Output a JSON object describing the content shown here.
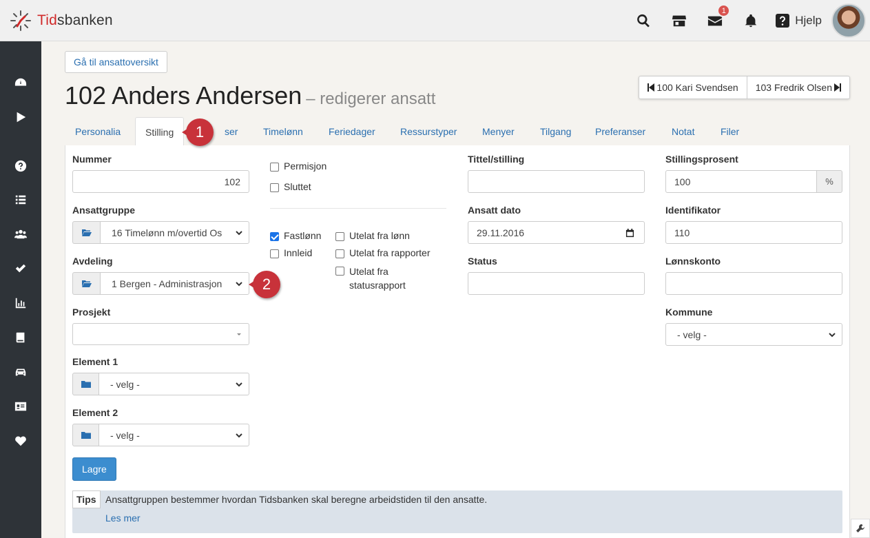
{
  "app": {
    "logo_prefix": "Tid",
    "logo_suffix": "sbanken"
  },
  "topbar": {
    "mail_badge": "1",
    "help_label": "Hjelp"
  },
  "sidebar": {
    "items": [
      "dashboard-icon",
      "play-icon",
      "question-icon",
      "list-icon",
      "users-icon",
      "check-icon",
      "chart-icon",
      "book-icon",
      "car-icon",
      "id-card-icon",
      "heart-icon"
    ]
  },
  "header": {
    "overview_button": "Gå til ansattoversikt",
    "title": "102 Anders Andersen",
    "subtitle": "– redigerer ansatt",
    "prev_employee": "100 Kari Svendsen",
    "next_employee": "103 Fredrik Olsen"
  },
  "tabs": [
    "Personalia",
    "Stilling",
    "ser",
    "Timelønn",
    "Feriedager",
    "Ressurstyper",
    "Menyer",
    "Tilgang",
    "Preferanser",
    "Notat",
    "Filer"
  ],
  "form": {
    "nummer_label": "Nummer",
    "nummer_value": "102",
    "ansattgruppe_label": "Ansattgruppe",
    "ansattgruppe_value": "16 Timelønn m/overtid Os",
    "avdeling_label": "Avdeling",
    "avdeling_value": "1 Bergen - Administrasjon",
    "prosjekt_label": "Prosjekt",
    "prosjekt_value": "",
    "element1_label": "Element 1",
    "element1_value": "- velg -",
    "element2_label": "Element 2",
    "element2_value": "- velg -",
    "permisjon_label": "Permisjon",
    "sluttet_label": "Sluttet",
    "fastlonn_label": "Fastlønn",
    "innleid_label": "Innleid",
    "utelat_lonn_label": "Utelat fra lønn",
    "utelat_rapporter_label": "Utelat fra rapporter",
    "utelat_status_line1": "Utelat fra",
    "utelat_status_line2": "statusrapport",
    "tittel_label": "Tittel/stilling",
    "tittel_value": "",
    "ansatt_dato_label": "Ansatt dato",
    "ansatt_dato_value": "29.11.2016",
    "status_label": "Status",
    "status_value": "",
    "stillingsprosent_label": "Stillingsprosent",
    "stillingsprosent_value": "100",
    "stillingsprosent_suffix": "%",
    "identifikator_label": "Identifikator",
    "identifikator_value": "110",
    "lonnskonto_label": "Lønnskonto",
    "lonnskonto_value": "",
    "kommune_label": "Kommune",
    "kommune_value": "- velg -",
    "save_label": "Lagre"
  },
  "tips": {
    "label": "Tips",
    "text": "Ansattgruppen bestemmer hvordan Tidsbanken skal beregne arbeidstiden til den ansatte.",
    "link": "Les mer"
  },
  "callouts": {
    "one": "1",
    "two": "2"
  },
  "colors": {
    "brand_red": "#d02a2a",
    "link_blue": "#2a6fb0",
    "sidebar_bg": "#2e3338",
    "callout_red": "#c8323a",
    "save_blue": "#3c8dcf"
  }
}
